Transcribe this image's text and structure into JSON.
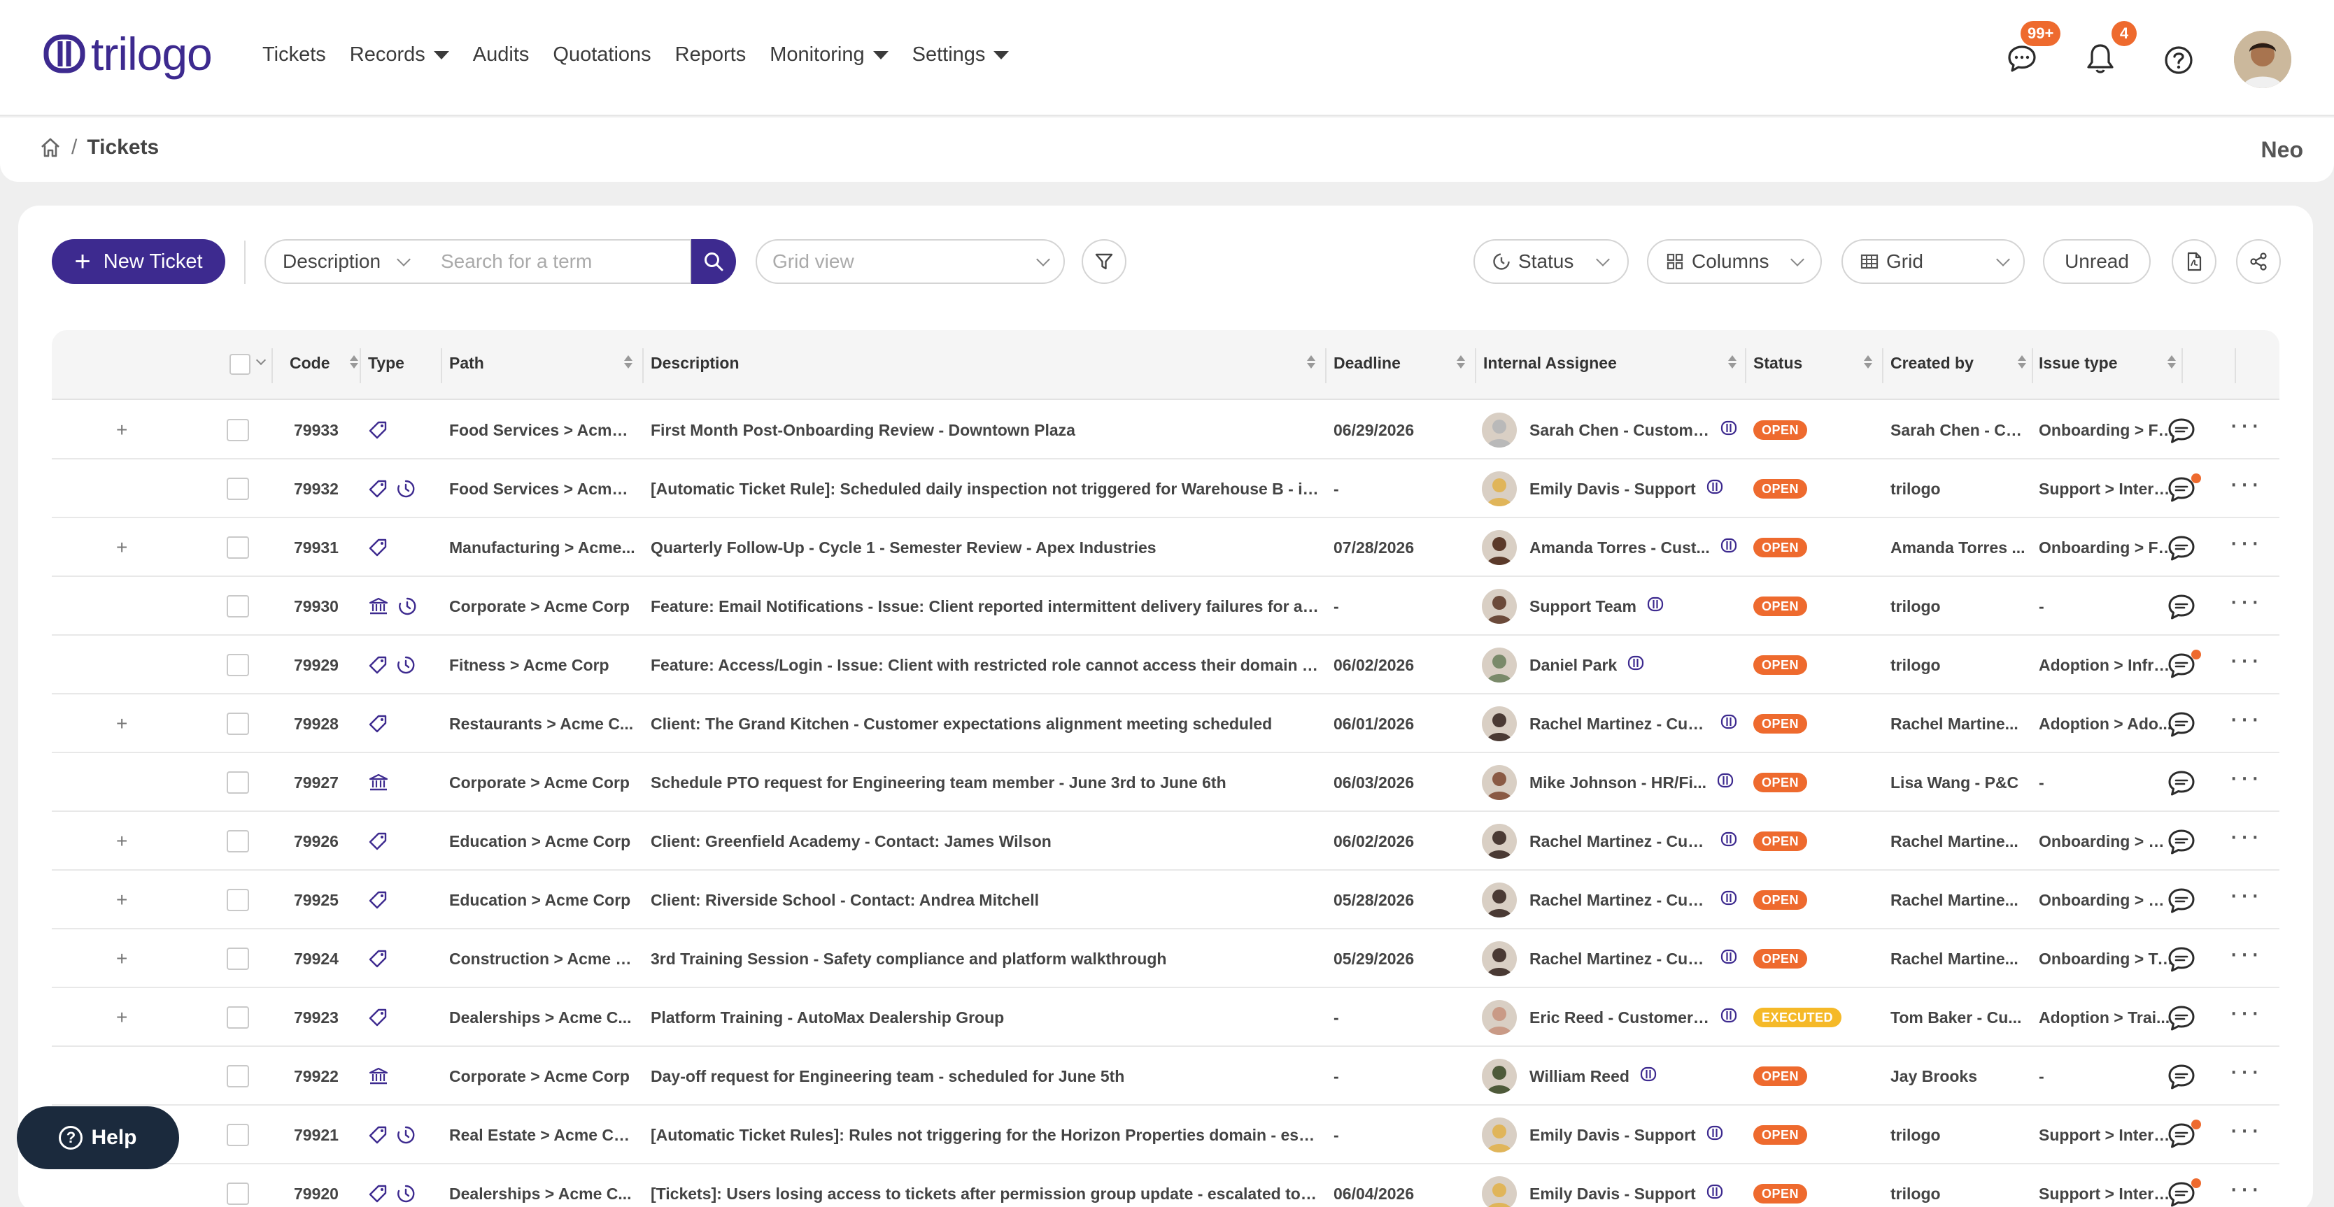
{
  "app": {
    "logo_text": "trilogo",
    "menu": [
      {
        "label": "Tickets",
        "dropdown": false
      },
      {
        "label": "Records",
        "dropdown": true
      },
      {
        "label": "Audits",
        "dropdown": false
      },
      {
        "label": "Quotations",
        "dropdown": false
      },
      {
        "label": "Reports",
        "dropdown": false
      },
      {
        "label": "Monitoring",
        "dropdown": true
      },
      {
        "label": "Settings",
        "dropdown": true
      }
    ],
    "messages_badge": "99+",
    "notifications_badge": "4",
    "accent_color": "#3d2a8f",
    "badge_color": "#ee6a2e"
  },
  "breadcrumb": {
    "current": "Tickets",
    "separator": "/"
  },
  "user": {
    "name": "Neo"
  },
  "toolbar": {
    "new_ticket_label": "New Ticket",
    "filter_field": "Description",
    "search_placeholder": "Search for a term",
    "grid_view_placeholder": "Grid view",
    "status_label": "Status",
    "columns_label": "Columns",
    "grid_label": "Grid",
    "unread_label": "Unread"
  },
  "table": {
    "columns": [
      "Code",
      "Type",
      "Path",
      "Description",
      "Deadline",
      "Internal Assignee",
      "Status",
      "Created by",
      "Issue type"
    ],
    "rows": [
      {
        "expand": true,
        "code": "79933",
        "types": [
          "tag"
        ],
        "path": "Food Services > Acme ...",
        "description": "First Month Post-Onboarding Review - Downtown Plaza",
        "deadline": "06/29/2026",
        "assignee": "Sarah Chen - Custome...",
        "avatar": "#b9b9b9",
        "status": "OPEN",
        "created_by": "Sarah Chen - Cu...",
        "issue_type": "Onboarding > Fi...",
        "unread": false
      },
      {
        "expand": false,
        "code": "79932",
        "types": [
          "tag",
          "clock"
        ],
        "path": "Food Services > Acme ...",
        "description": "[Automatic Ticket Rule]: Scheduled daily inspection not triggered for Warehouse B - inv...",
        "deadline": "-",
        "assignee": "Emily Davis - Support",
        "avatar": "#e0b55a",
        "status": "OPEN",
        "created_by": "trilogo",
        "issue_type": "Support > Intern...",
        "unread": true
      },
      {
        "expand": true,
        "code": "79931",
        "types": [
          "tag"
        ],
        "path": "Manufacturing > Acme...",
        "description": "Quarterly Follow-Up - Cycle 1 - Semester Review - Apex Industries",
        "deadline": "07/28/2026",
        "assignee": "Amanda Torres - Cust...",
        "avatar": "#5b3a2a",
        "status": "OPEN",
        "created_by": "Amanda Torres ...",
        "issue_type": "Onboarding > Fi...",
        "unread": false
      },
      {
        "expand": false,
        "code": "79930",
        "types": [
          "bank",
          "clock"
        ],
        "path": "Corporate > Acme Corp",
        "description": "Feature: Email Notifications - Issue: Client reported intermittent delivery failures for as...",
        "deadline": "-",
        "assignee": "Support Team",
        "avatar": "#6b4a3a",
        "status": "OPEN",
        "created_by": "trilogo",
        "issue_type": "-",
        "unread": false
      },
      {
        "expand": false,
        "code": "79929",
        "types": [
          "tag",
          "clock"
        ],
        "path": "Fitness > Acme Corp",
        "description": "Feature: Access/Login - Issue: Client with restricted role cannot access their domain d...",
        "deadline": "06/02/2026",
        "assignee": "Daniel Park",
        "avatar": "#7a8a6a",
        "status": "OPEN",
        "created_by": "trilogo",
        "issue_type": "Adoption > Infra...",
        "unread": true
      },
      {
        "expand": true,
        "code": "79928",
        "types": [
          "tag"
        ],
        "path": "Restaurants > Acme C...",
        "description": "Client: The Grand Kitchen - Customer expectations alignment meeting scheduled",
        "deadline": "06/01/2026",
        "assignee": "Rachel Martinez - Cus...",
        "avatar": "#4a3a34",
        "status": "OPEN",
        "created_by": "Rachel Martine...",
        "issue_type": "Adoption > Ado...",
        "unread": false
      },
      {
        "expand": false,
        "code": "79927",
        "types": [
          "bank"
        ],
        "path": "Corporate > Acme Corp",
        "description": "Schedule PTO request for Engineering team member - June 3rd to June 6th",
        "deadline": "06/03/2026",
        "assignee": "Mike Johnson - HR/Fi...",
        "avatar": "#8a5a44",
        "status": "OPEN",
        "created_by": "Lisa Wang - P&C",
        "issue_type": "-",
        "unread": false
      },
      {
        "expand": true,
        "code": "79926",
        "types": [
          "tag"
        ],
        "path": "Education > Acme Corp",
        "description": "Client: Greenfield Academy - Contact: James Wilson",
        "deadline": "06/02/2026",
        "assignee": "Rachel Martinez - Cus...",
        "avatar": "#4a3a34",
        "status": "OPEN",
        "created_by": "Rachel Martine...",
        "issue_type": "Onboarding > Ki...",
        "unread": false
      },
      {
        "expand": true,
        "code": "79925",
        "types": [
          "tag"
        ],
        "path": "Education > Acme Corp",
        "description": "Client: Riverside School - Contact: Andrea Mitchell",
        "deadline": "05/28/2026",
        "assignee": "Rachel Martinez - Cus...",
        "avatar": "#4a3a34",
        "status": "OPEN",
        "created_by": "Rachel Martine...",
        "issue_type": "Onboarding > Ki...",
        "unread": false
      },
      {
        "expand": true,
        "code": "79924",
        "types": [
          "tag"
        ],
        "path": "Construction > Acme C...",
        "description": "3rd Training Session - Safety compliance and platform walkthrough",
        "deadline": "05/29/2026",
        "assignee": "Rachel Martinez - Cus...",
        "avatar": "#4a3a34",
        "status": "OPEN",
        "created_by": "Rachel Martine...",
        "issue_type": "Onboarding > Tr...",
        "unread": false
      },
      {
        "expand": true,
        "code": "79923",
        "types": [
          "tag"
        ],
        "path": "Dealerships > Acme C...",
        "description": "Platform Training - AutoMax Dealership Group",
        "deadline": "-",
        "assignee": "Eric Reed - Customer ...",
        "avatar": "#c99a86",
        "status": "EXECUTED",
        "created_by": "Tom Baker - Cu...",
        "issue_type": "Adoption > Trai...",
        "unread": false
      },
      {
        "expand": false,
        "code": "79922",
        "types": [
          "bank"
        ],
        "path": "Corporate > Acme Corp",
        "description": "Day-off request for Engineering team - scheduled for June 5th",
        "deadline": "-",
        "assignee": "William Reed",
        "avatar": "#4e5a3a",
        "status": "OPEN",
        "created_by": "Jay Brooks",
        "issue_type": "-",
        "unread": false
      },
      {
        "expand": false,
        "code": "79921",
        "types": [
          "tag",
          "clock"
        ],
        "path": "Real Estate > Acme Corp",
        "description": "[Automatic Ticket Rules]: Rules not triggering for the Horizon Properties domain - esca...",
        "deadline": "-",
        "assignee": "Emily Davis - Support",
        "avatar": "#e0b55a",
        "status": "OPEN",
        "created_by": "trilogo",
        "issue_type": "Support > Intern...",
        "unread": true
      },
      {
        "expand": false,
        "code": "79920",
        "types": [
          "tag",
          "clock"
        ],
        "path": "Dealerships > Acme C...",
        "description": "[Tickets]: Users losing access to tickets after permission group update - escalated to e...",
        "deadline": "06/04/2026",
        "assignee": "Emily Davis - Support",
        "avatar": "#e0b55a",
        "status": "OPEN",
        "created_by": "trilogo",
        "issue_type": "Support > Intern...",
        "unread": true
      }
    ]
  },
  "status_colors": {
    "OPEN": "#ee6a2e",
    "EXECUTED": "#f5b928"
  },
  "help": {
    "label": "Help"
  }
}
